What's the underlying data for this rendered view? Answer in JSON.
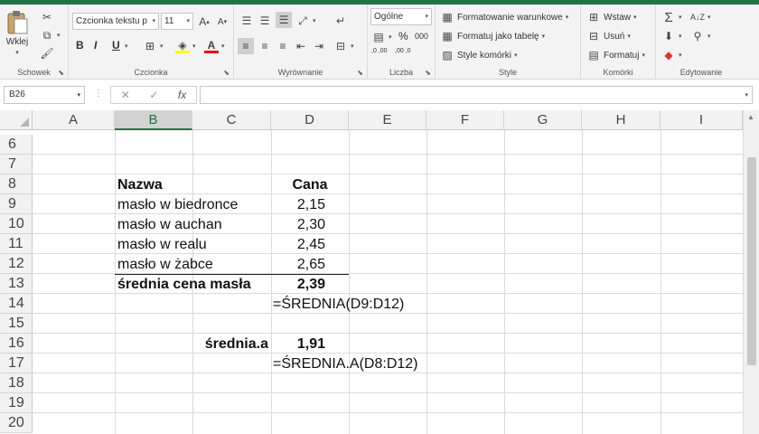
{
  "ribbon": {
    "clipboard": {
      "paste_label": "Wklej",
      "group_label": "Schowek"
    },
    "font": {
      "font_name": "Czcionka tekstu p",
      "font_size": "11",
      "bold": "B",
      "italic": "I",
      "underline": "U",
      "font_color_glyph": "A",
      "group_label": "Czcionka"
    },
    "alignment": {
      "group_label": "Wyrównanie"
    },
    "number": {
      "format_value": "Ogólne",
      "percent": "%",
      "comma": "000",
      "inc_decimal": ",0 ,00",
      "dec_decimal": ",00 ,0",
      "group_label": "Liczba"
    },
    "styles": {
      "conditional": "Formatowanie warunkowe",
      "as_table": "Formatuj jako tabelę",
      "cell_styles": "Style komórki",
      "group_label": "Style"
    },
    "cells": {
      "insert": "Wstaw",
      "delete": "Usuń",
      "format": "Formatuj",
      "group_label": "Komórki"
    },
    "editing": {
      "group_label": "Edytowanie"
    }
  },
  "formula_bar": {
    "name_box": "B26",
    "cancel": "✕",
    "enter": "✓",
    "fx": "fx",
    "content": ""
  },
  "columns": [
    "A",
    "B",
    "C",
    "D",
    "E",
    "F",
    "G",
    "H",
    "I"
  ],
  "selected_column": "B",
  "rows": [
    "6",
    "7",
    "8",
    "9",
    "10",
    "11",
    "12",
    "13",
    "14",
    "15",
    "16",
    "17",
    "18",
    "19",
    "20"
  ],
  "cells": {
    "b8": "Nazwa",
    "d8": "Cana",
    "b9": "masło w biedronce",
    "d9": "2,15",
    "b10": "masło w auchan",
    "d10": "2,30",
    "b11": "masło w realu",
    "d11": "2,45",
    "b12": "masło w żabce",
    "d12": "2,65",
    "b13": "średnia cena masła",
    "d13": "2,39",
    "d14": "=ŚREDNIA(D9:D12)",
    "c16": "średnia.a",
    "d16": "1,91",
    "d17": "=ŚREDNIA.A(D8:D12)"
  },
  "colors": {
    "accent": "#217346"
  }
}
